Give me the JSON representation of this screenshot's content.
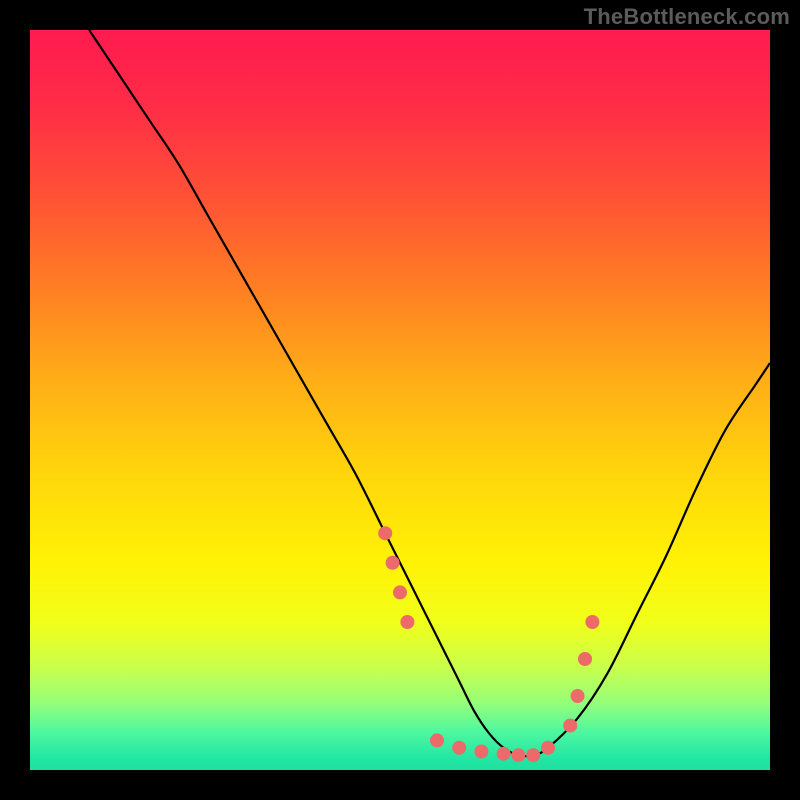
{
  "watermark": {
    "text": "TheBottleneck.com"
  },
  "gradient_stops": [
    {
      "offset": 0.0,
      "color": "#ff1a4f"
    },
    {
      "offset": 0.1,
      "color": "#ff2c47"
    },
    {
      "offset": 0.22,
      "color": "#ff5036"
    },
    {
      "offset": 0.35,
      "color": "#ff7f23"
    },
    {
      "offset": 0.48,
      "color": "#ffb016"
    },
    {
      "offset": 0.6,
      "color": "#ffd60b"
    },
    {
      "offset": 0.72,
      "color": "#fff205"
    },
    {
      "offset": 0.8,
      "color": "#f1ff19"
    },
    {
      "offset": 0.86,
      "color": "#caff4a"
    },
    {
      "offset": 0.91,
      "color": "#94ff7a"
    },
    {
      "offset": 0.95,
      "color": "#4cf7a1"
    },
    {
      "offset": 0.985,
      "color": "#21e6a2"
    },
    {
      "offset": 1.0,
      "color": "#1fe0a0"
    }
  ],
  "chart_data": {
    "type": "line",
    "title": "",
    "xlabel": "",
    "ylabel": "",
    "xlim": [
      0,
      100
    ],
    "ylim": [
      0,
      100
    ],
    "grid": false,
    "legend": false,
    "series": [
      {
        "name": "curve",
        "color": "#000000",
        "x": [
          8,
          12,
          16,
          20,
          24,
          28,
          32,
          36,
          40,
          44,
          48,
          52,
          54,
          56,
          58,
          60,
          62,
          64,
          66,
          68,
          70,
          74,
          78,
          82,
          86,
          90,
          94,
          98,
          100
        ],
        "y": [
          100,
          94,
          88,
          82,
          75,
          68,
          61,
          54,
          47,
          40,
          32,
          24,
          20,
          16,
          12,
          8,
          5,
          3,
          2,
          2,
          3,
          7,
          13,
          21,
          29,
          38,
          46,
          52,
          55
        ]
      }
    ],
    "markers": {
      "name": "dots",
      "color": "#ec6a6a",
      "radius_px": 7,
      "x": [
        48,
        49,
        50,
        51,
        55,
        58,
        61,
        64,
        66,
        68,
        70,
        73,
        74,
        75,
        76
      ],
      "y": [
        32,
        28,
        24,
        20,
        4,
        3,
        2.5,
        2.2,
        2,
        2,
        3,
        6,
        10,
        15,
        20
      ]
    }
  }
}
